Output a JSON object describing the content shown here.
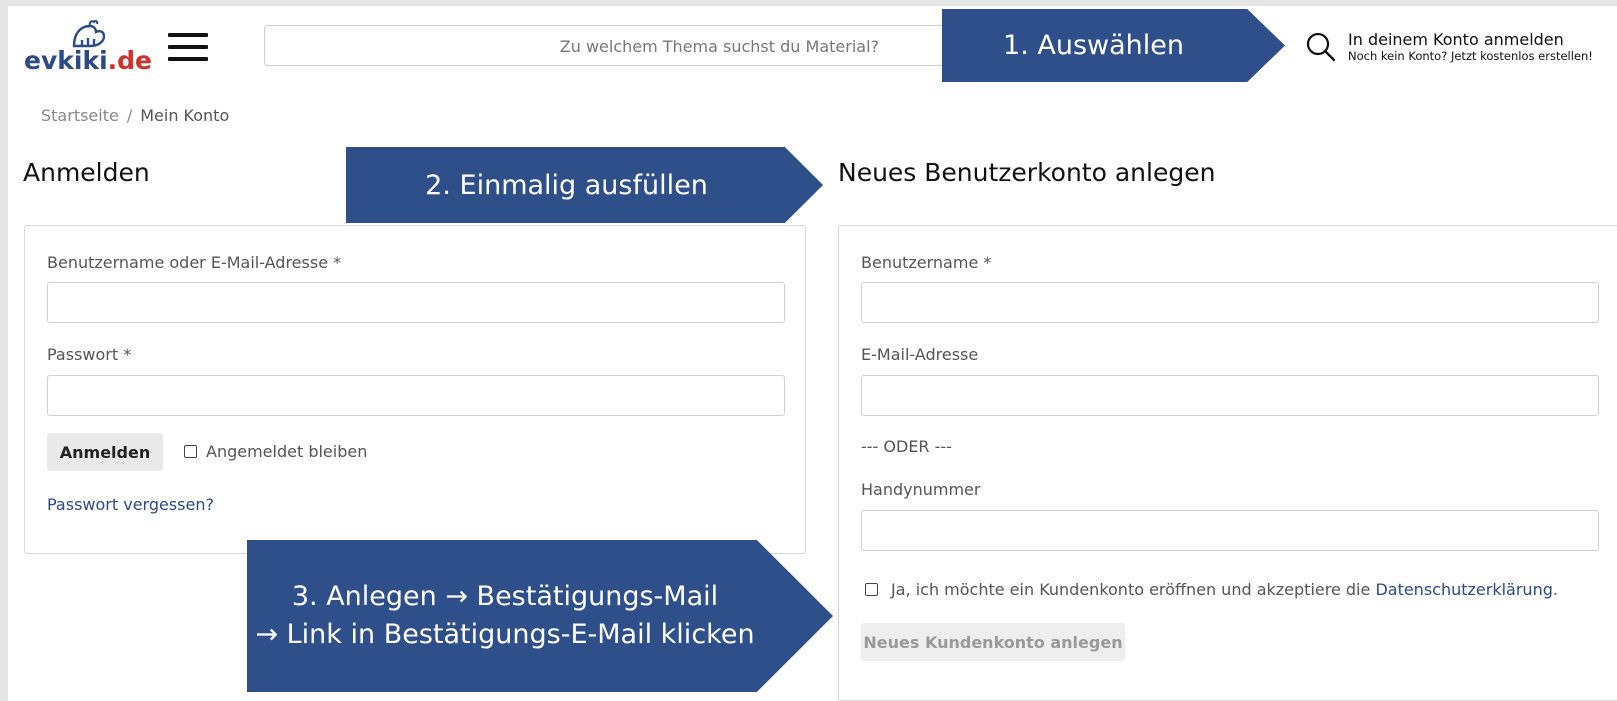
{
  "header": {
    "logo_text": "evkiki",
    "logo_tld": ".de",
    "search_placeholder": "Zu welchem Thema suchst du Material?",
    "account_title": "In deinem Konto anmelden",
    "account_subtitle": "Noch kein Konto? Jetzt kostenlos erstellen!"
  },
  "breadcrumb": {
    "home": "Startseite",
    "separator": "/",
    "current": "Mein Konto"
  },
  "callouts": {
    "step1": "1. Auswählen",
    "step2": "2. Einmalig ausfüllen",
    "step3_line1": "3. Anlegen → Bestätigungs-Mail",
    "step3_line2": "→ Link in Bestätigungs-E-Mail klicken"
  },
  "login": {
    "heading": "Anmelden",
    "username_label": "Benutzername oder E-Mail-Adresse *",
    "username_value": "",
    "password_label": "Passwort *",
    "password_value": "",
    "submit_label": "Anmelden",
    "remember_label": "Angemeldet bleiben",
    "forgot_label": "Passwort vergessen?"
  },
  "register": {
    "heading": "Neues Benutzerkonto anlegen",
    "username_label": "Benutzername *",
    "email_label": "E-Mail-Adresse",
    "or_separator": "--- ODER ---",
    "phone_label": "Handynummer",
    "terms_text": "Ja, ich möchte ein Kundenkonto eröffnen und akzeptiere die",
    "terms_link": "Datenschutzerklärung",
    "terms_end": ".",
    "submit_label": "Neues Kundenkonto anlegen"
  },
  "colors": {
    "brand": "#2c4a86",
    "callout": "#2f4f8b",
    "logo_dot": "#d0312d"
  },
  "icons": [
    "rooster-logo-icon",
    "hamburger-menu-icon",
    "search-icon",
    "checkbox-icon"
  ]
}
